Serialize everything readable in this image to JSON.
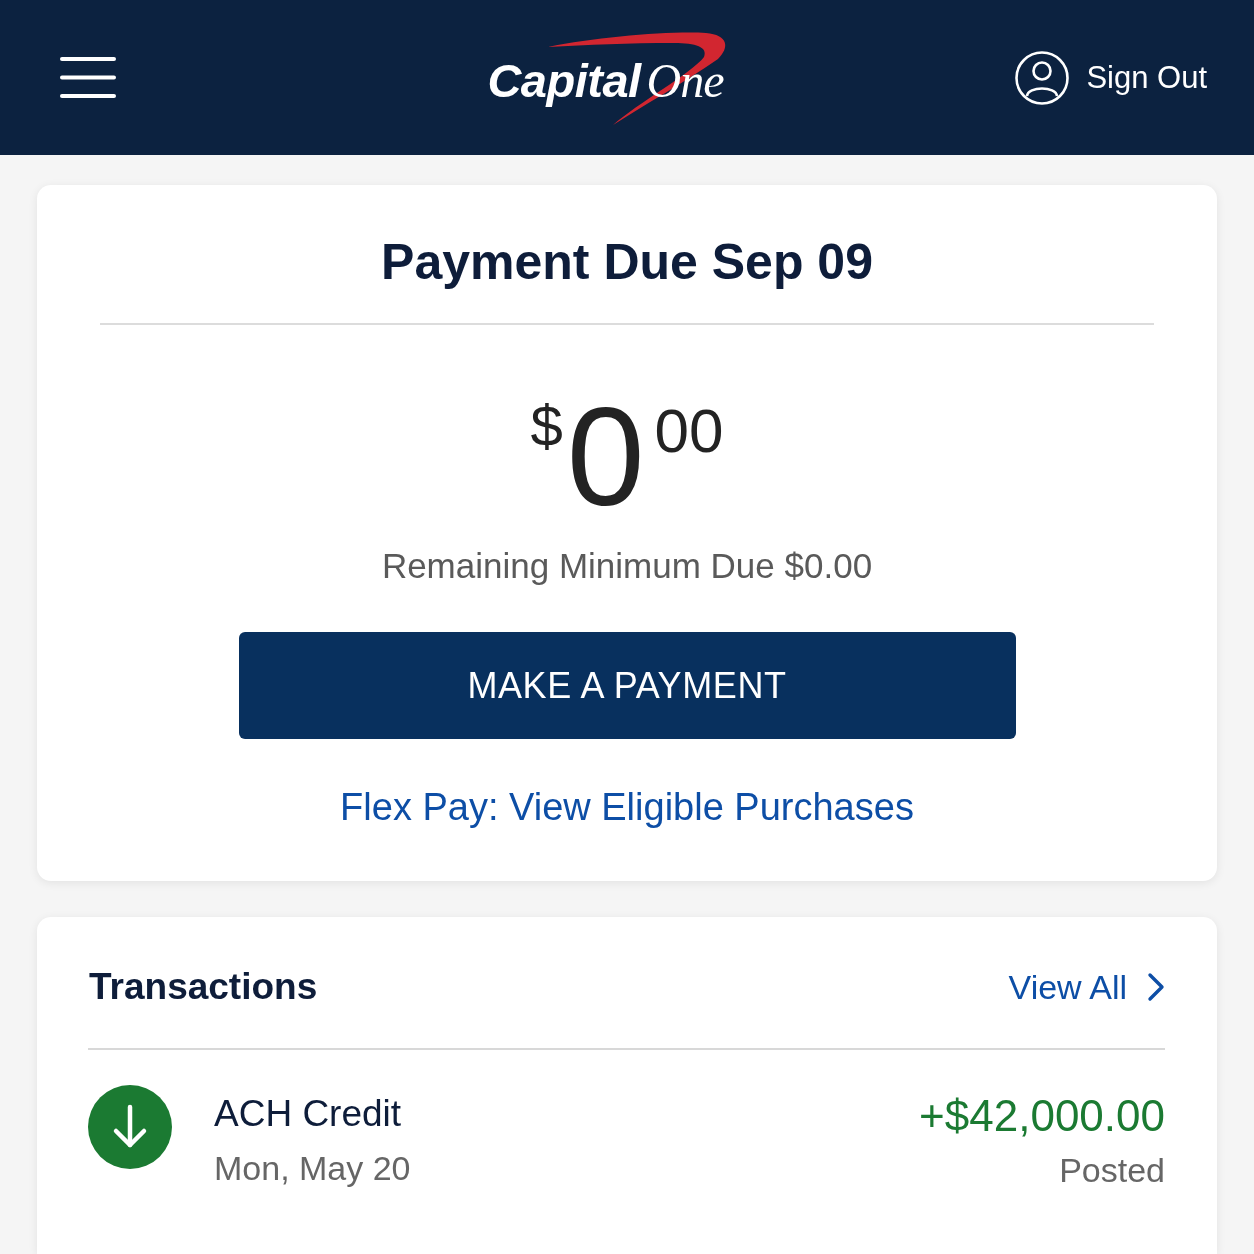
{
  "header": {
    "logo": "**Capital**One",
    "sign_out": "Sign Out"
  },
  "payment_card": {
    "title": "Payment Due Sep 09",
    "amount": {
      "currency": "$",
      "whole": "0",
      "cents": "00"
    },
    "minimum_due": "Remaining Minimum Due $0.00",
    "button": "MAKE A PAYMENT",
    "link": "Flex Pay: View Eligible Purchases"
  },
  "transactions": {
    "title": "Transactions",
    "view_all": "View All",
    "items": [
      {
        "kind": "credit",
        "name": "ACH Credit",
        "date": "Mon, May 20",
        "amount": "+$42,000.00",
        "status": "Posted"
      }
    ]
  }
}
